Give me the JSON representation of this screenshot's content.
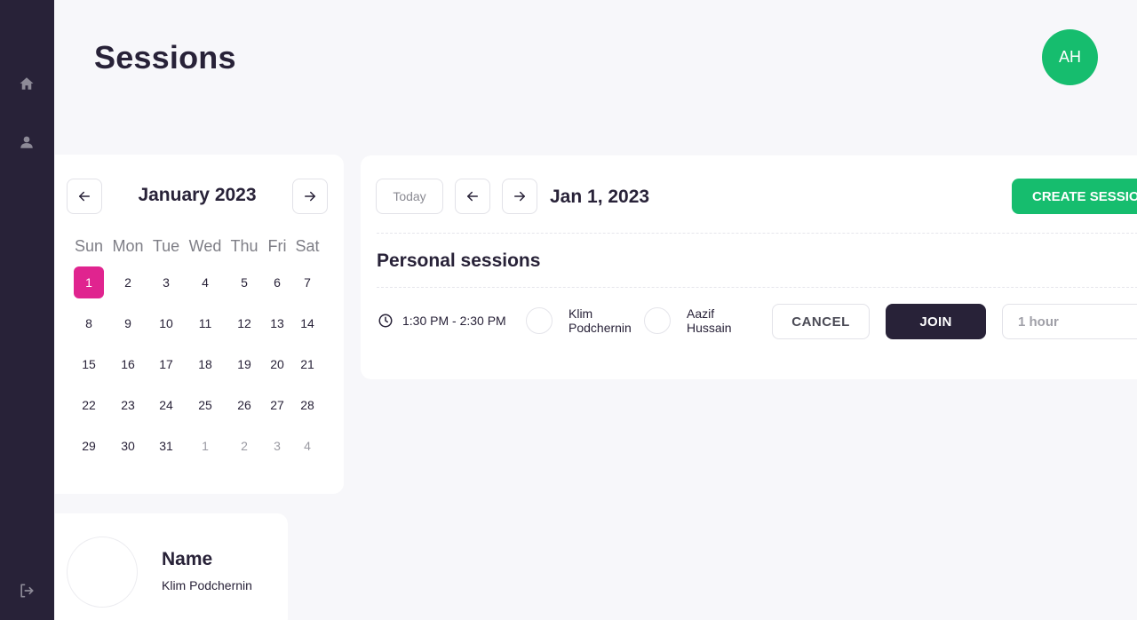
{
  "page": {
    "title": "Sessions"
  },
  "user": {
    "initials": "AH"
  },
  "sidebar": {
    "items": [
      {
        "name": "home",
        "icon": "home-icon"
      },
      {
        "name": "profile",
        "icon": "user-icon"
      },
      {
        "name": "logout",
        "icon": "logout-icon"
      }
    ]
  },
  "calendar": {
    "month_label": "January 2023",
    "weekdays": [
      "Sun",
      "Mon",
      "Tue",
      "Wed",
      "Thu",
      "Fri",
      "Sat"
    ],
    "weeks": [
      [
        "1",
        "2",
        "3",
        "4",
        "5",
        "6",
        "7"
      ],
      [
        "8",
        "9",
        "10",
        "11",
        "12",
        "13",
        "14"
      ],
      [
        "15",
        "16",
        "17",
        "18",
        "19",
        "20",
        "21"
      ],
      [
        "22",
        "23",
        "24",
        "25",
        "26",
        "27",
        "28"
      ],
      [
        "29",
        "30",
        "31",
        "1",
        "2",
        "3",
        "4"
      ]
    ],
    "selected_day": "1"
  },
  "profile": {
    "label": "Name",
    "name": "Klim Podchernin"
  },
  "sessions": {
    "today_label": "Today",
    "date_label": "Jan 1, 2023",
    "create_label": "CREATE SESSION",
    "section_title": "Personal sessions",
    "items": [
      {
        "time": "1:30 PM - 2:30 PM",
        "participant_1": "Klim Podchernin",
        "participant_2": "Aazif Hussain",
        "cancel_label": "CANCEL",
        "join_label": "JOIN",
        "duration": "1 hour"
      }
    ]
  },
  "colors": {
    "sidebar": "#282238",
    "accent_green": "#16bd6e",
    "selected_day": "#e0248f",
    "join_button": "#282238"
  }
}
